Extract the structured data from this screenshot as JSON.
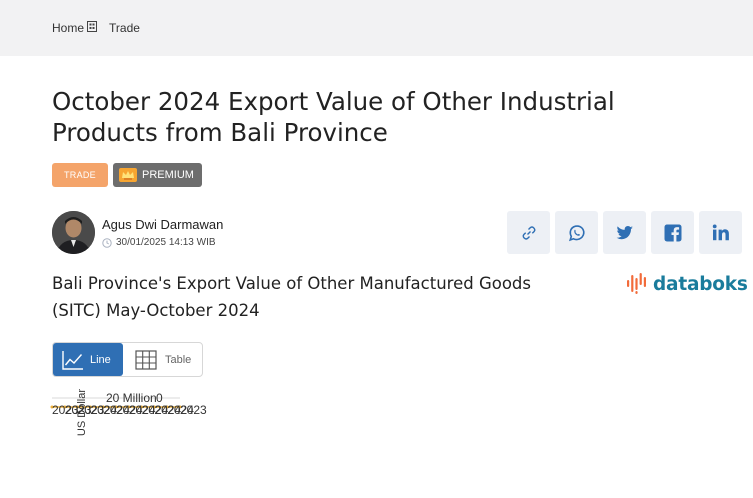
{
  "breadcrumb": {
    "home": "Home",
    "current": "Trade"
  },
  "title": "October 2024 Export Value of Other Industrial Products from Bali Province",
  "tags": {
    "category": "TRADE",
    "premium": "PREMIUM"
  },
  "author": {
    "name": "Agus Dwi Darmawan",
    "datetime": "30/01/2025 14:13 WIB"
  },
  "share": {
    "icons": [
      "link-icon",
      "whatsapp-icon",
      "twitter-icon",
      "facebook-icon",
      "linkedin-icon"
    ]
  },
  "chart_title": "Bali Province's Export Value of Other Manufactured Goods (SITC) May-October 2024",
  "brand": {
    "name": "databoks",
    "color": "#1a7c9c"
  },
  "view_toggle": {
    "line_label": "Line",
    "table_label": "Table",
    "active": "Line"
  },
  "chart_data": {
    "type": "line",
    "ylabel": "US Dollar",
    "tick_y": [
      "20 Million",
      "0"
    ],
    "x_labels": [
      "2023",
      "2023",
      "2023",
      "2024",
      "2024",
      "2024",
      "2024",
      "2024",
      "2024",
      "2024",
      "2023"
    ],
    "ylim": [
      0,
      20000000
    ],
    "series": [
      {
        "values": [
          0,
          0,
          0,
          0,
          0,
          0,
          0,
          0,
          0,
          0,
          0
        ]
      }
    ],
    "colors": {
      "line": "#f0b23a",
      "grid": "#d9d9d9"
    }
  }
}
